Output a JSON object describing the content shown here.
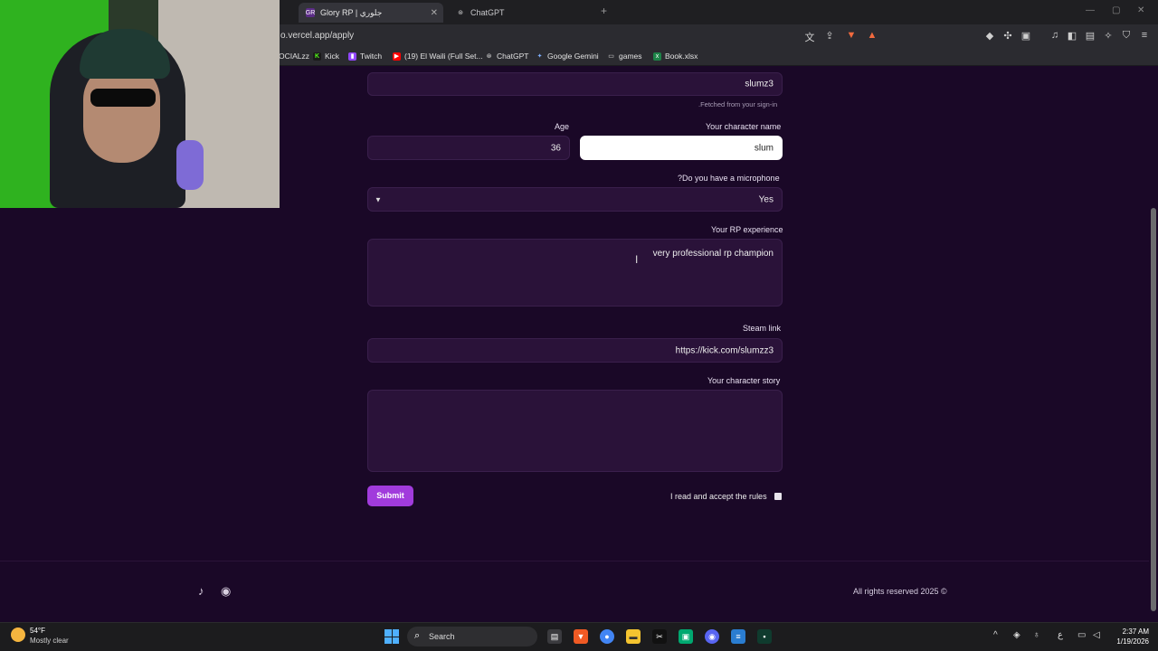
{
  "browser": {
    "tabs": [
      {
        "title": "Glory RP | جلوري",
        "active": true
      },
      {
        "title": "ChatGPT",
        "active": false
      }
    ],
    "url": "o.vercel.app/apply",
    "bookmarks": [
      "OCIALzz",
      "Kick",
      "Twitch",
      "(19) El Waili (Full Set...",
      "ChatGPT",
      "Google Gemini",
      "games",
      "Book.xlsx"
    ],
    "extension_badge": "2"
  },
  "form": {
    "username_value": "slumz3",
    "username_hint": ".Fetched from your sign-in",
    "age_label": "Age",
    "age_value": "36",
    "character_name_label": "Your character name",
    "character_name_value": "slum",
    "microphone_label": "?Do you have a microphone",
    "microphone_value": "Yes",
    "rp_experience_label": "Your RP experience",
    "rp_experience_value": "very professional rp champion",
    "steam_label": "Steam link",
    "steam_value": "https://kick.com/slumzz3",
    "story_label": "Your character story",
    "story_value": "",
    "accept_label": "I read and accept the rules",
    "submit_label": "Submit"
  },
  "footer": {
    "copyright": "All rights reserved 2025 ©",
    "social_icons": [
      "tiktok-icon",
      "discord-icon"
    ]
  },
  "taskbar": {
    "temperature": "54°F",
    "weather": "Mostly clear",
    "search_label": "Search",
    "time": "2:37 AM",
    "date": "1/19/2026",
    "lang": "ع"
  },
  "colors": {
    "page_bg": "#1a0827",
    "field_bg": "#2a1239",
    "accent": "#a13bdc"
  }
}
